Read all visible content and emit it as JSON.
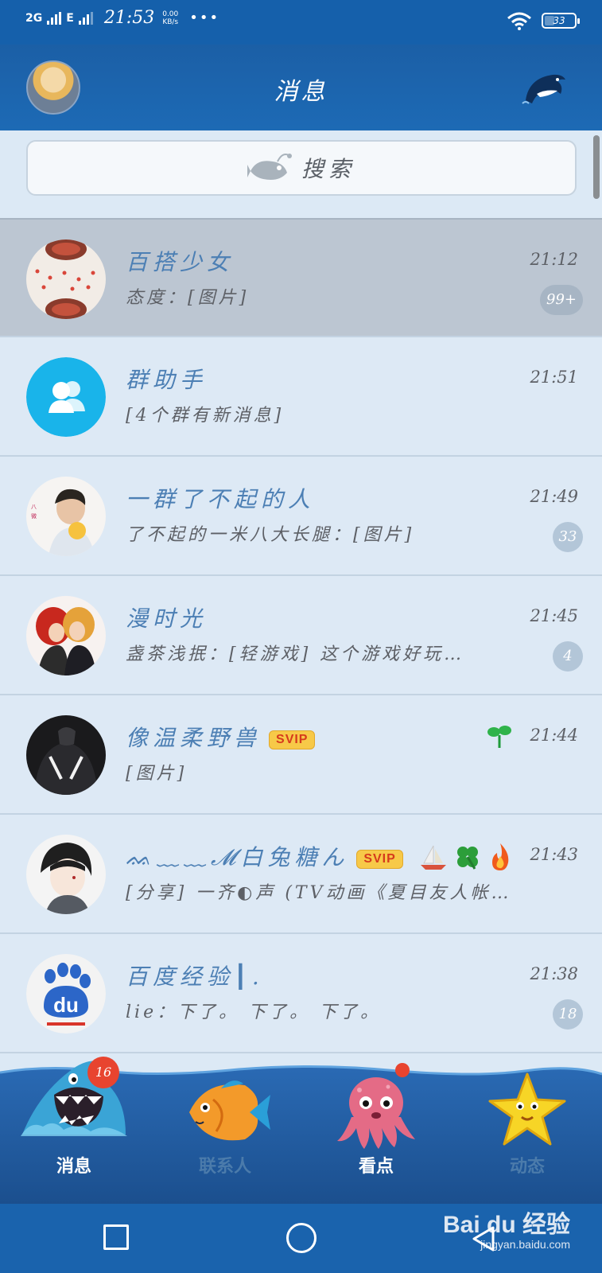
{
  "status_bar": {
    "network": "2G",
    "network2": "E",
    "time": "21:53",
    "speed_value": "0.00",
    "speed_unit": "KB/s",
    "more": "•••",
    "battery": "33"
  },
  "header": {
    "title": "消息"
  },
  "search": {
    "label": "搜索"
  },
  "chats": [
    {
      "name": "百搭少女",
      "preview": "态度：[图片]",
      "time": "21:12",
      "badge": "99+"
    },
    {
      "name": "群助手",
      "preview": "[4个群有新消息]",
      "time": "21:51",
      "badge": ""
    },
    {
      "name": "一群了不起的人",
      "preview": "了不起的一米八大长腿：[图片]",
      "time": "21:49",
      "badge": "33"
    },
    {
      "name": "漫时光",
      "preview": "盏茶浅抿：[轻游戏] 这个游戏好玩…",
      "time": "21:45",
      "badge": "4"
    },
    {
      "name": "像温柔野兽",
      "tag": "SVIP",
      "preview": "[图片]",
      "time": "21:44",
      "badge": ""
    },
    {
      "name": "ᨐ﹏﹏𝓜白兔糖ん",
      "tag": "SVIP",
      "preview": "[分享] 一齐◐声 (TV动画《夏目友人帐…",
      "time": "21:43",
      "badge": ""
    },
    {
      "name": "百度经验┃.",
      "preview": "lie：下了。 下了。 下了。",
      "time": "21:38",
      "badge": "18"
    }
  ],
  "bottom_nav": {
    "items": [
      {
        "label": "消息",
        "badge": "16"
      },
      {
        "label": "联系人"
      },
      {
        "label": "看点"
      },
      {
        "label": "动态"
      }
    ]
  },
  "watermark": {
    "brand": "Bai du 经验",
    "url": "jingyan.baidu.com"
  },
  "colors": {
    "header_blue": "#1d6ab5",
    "list_bg": "#dde9f5",
    "name_blue": "#4c7fb4",
    "badge_red": "#e8442f",
    "svip_yellow": "#f7c948"
  }
}
